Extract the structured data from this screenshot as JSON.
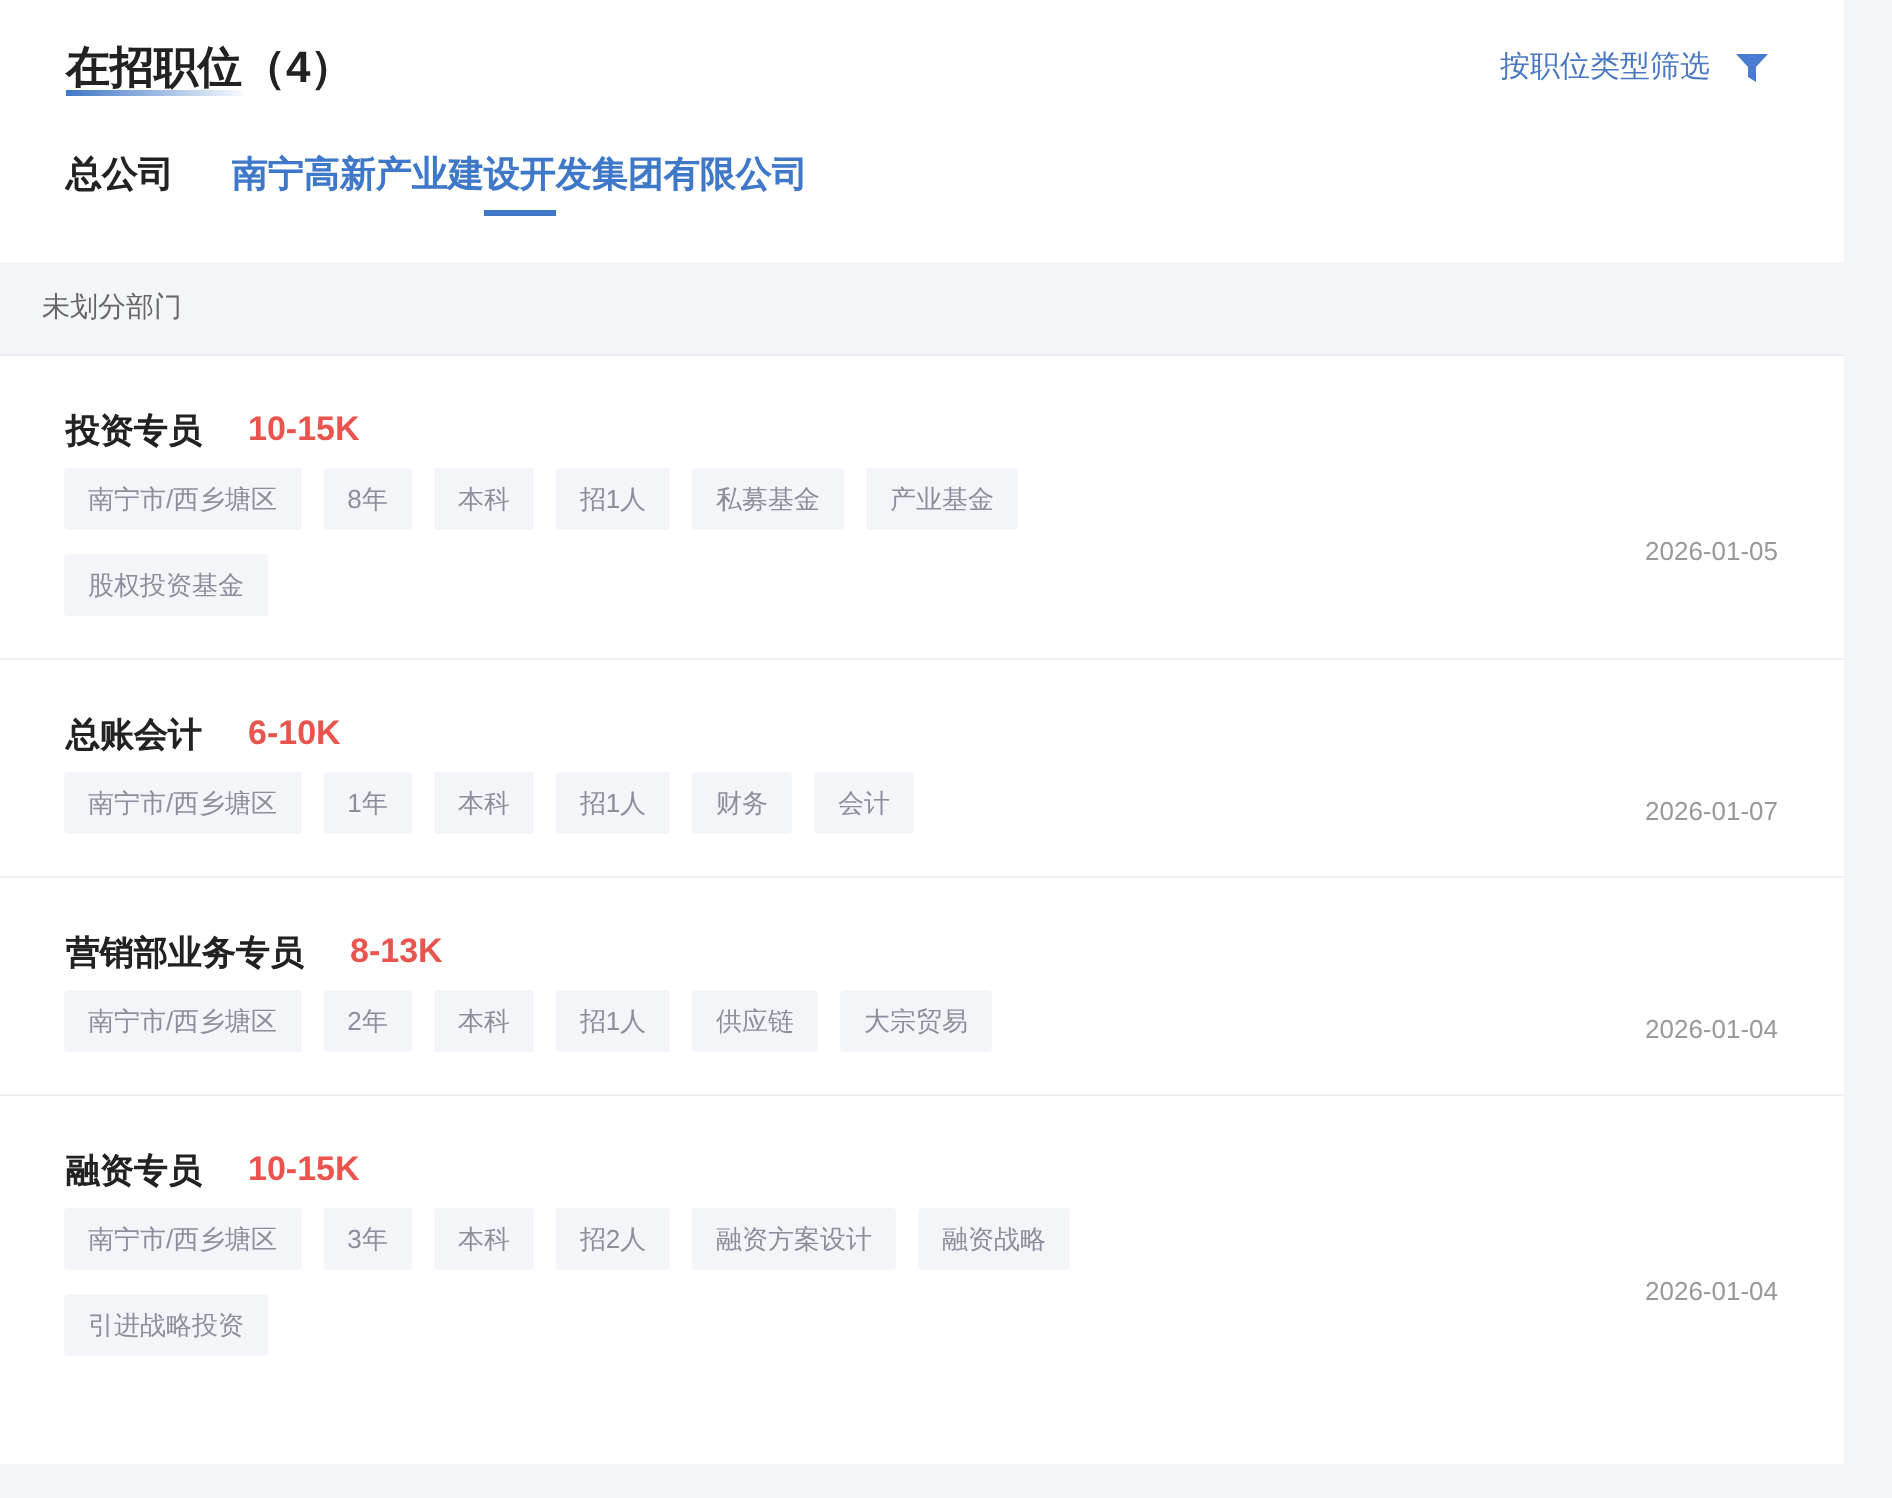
{
  "header": {
    "title": "在招职位（4）",
    "filter": {
      "label": "按职位类型筛选"
    }
  },
  "tabs": [
    {
      "label": "总公司",
      "selected": false
    },
    {
      "label": "南宁高新产业建设开发集团有限公司",
      "selected": true
    }
  ],
  "department": {
    "label": "未划分部门"
  },
  "jobs": [
    {
      "title": "投资专员",
      "salary": "10-15K",
      "tags": [
        "南宁市/西乡塘区",
        "8年",
        "本科",
        "招1人",
        "私募基金",
        "产业基金",
        "股权投资基金"
      ],
      "date": "2026-01-05"
    },
    {
      "title": "总账会计",
      "salary": "6-10K",
      "tags": [
        "南宁市/西乡塘区",
        "1年",
        "本科",
        "招1人",
        "财务",
        "会计"
      ],
      "date": "2026-01-07"
    },
    {
      "title": "营销部业务专员",
      "salary": "8-13K",
      "tags": [
        "南宁市/西乡塘区",
        "2年",
        "本科",
        "招1人",
        "供应链",
        "大宗贸易"
      ],
      "date": "2026-01-04"
    },
    {
      "title": "融资专员",
      "salary": "10-15K",
      "tags": [
        "南宁市/西乡塘区",
        "3年",
        "本科",
        "招2人",
        "融资方案设计",
        "融资战略",
        "引进战略投资"
      ],
      "date": "2026-01-04"
    }
  ]
}
